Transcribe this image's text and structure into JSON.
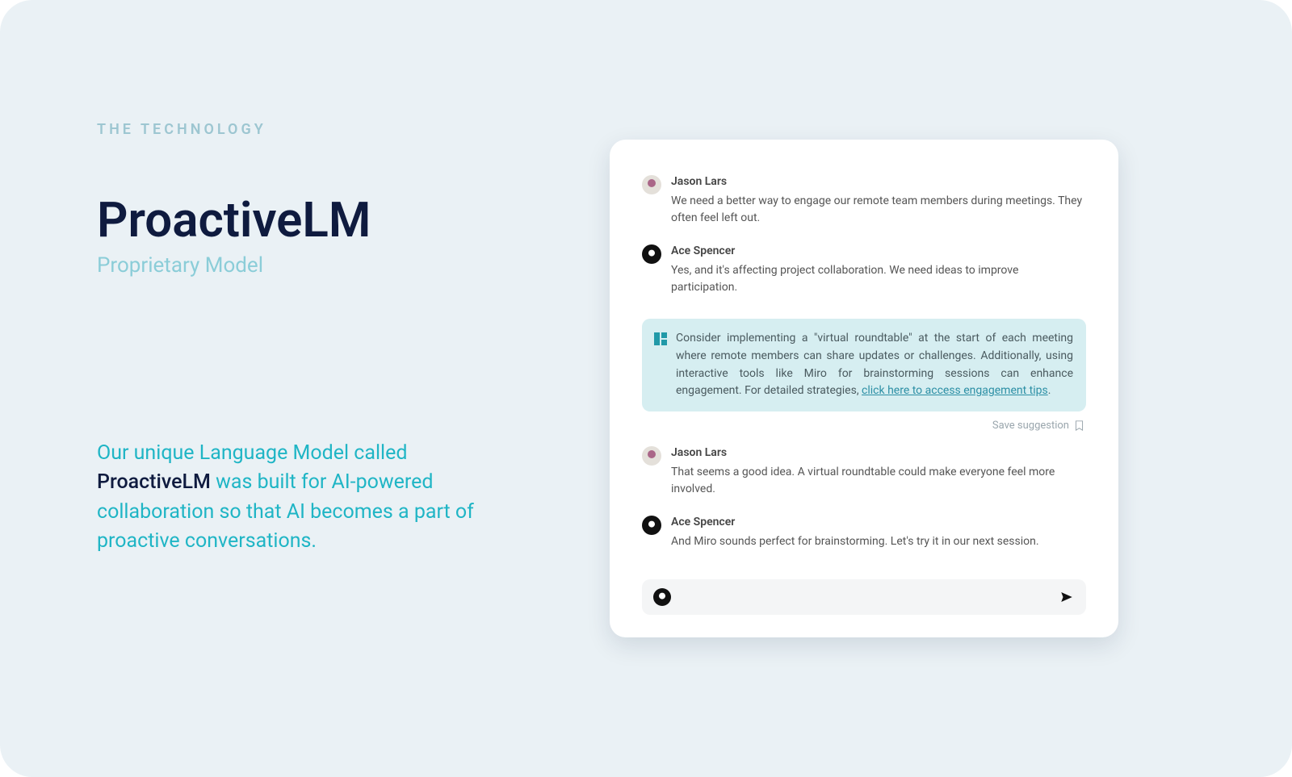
{
  "eyebrow": "THE TECHNOLOGY",
  "title": "ProactiveLM",
  "subtitle": "Proprietary Model",
  "desc_pre": "Our unique Language Model called ",
  "desc_strong": "ProactiveLM",
  "desc_post": " was built for AI-powered collaboration so that AI becomes a part of proactive conversations.",
  "chat": {
    "messages": [
      {
        "author": "Jason Lars",
        "text": "We need a better way to engage our remote team members during meetings. They often feel left out."
      },
      {
        "author": "Ace Spencer",
        "text": "Yes, and it's affecting project collaboration. We need ideas to improve participation."
      }
    ],
    "suggestion": {
      "text_pre": "Consider implementing a \"virtual roundtable\" at the start of each meeting where remote members can share updates or challenges. Additionally, using interactive tools like Miro for brainstorming sessions can enhance engagement. For detailed strategies, ",
      "link_label": "click here to access engagement tips",
      "text_post": "."
    },
    "save_label": "Save suggestion",
    "followups": [
      {
        "author": "Jason Lars",
        "text": "That seems a good idea. A virtual roundtable could make everyone feel more involved."
      },
      {
        "author": "Ace Spencer",
        "text": "And Miro sounds perfect for brainstorming. Let's try it in our next session."
      }
    ],
    "input_placeholder": ""
  }
}
